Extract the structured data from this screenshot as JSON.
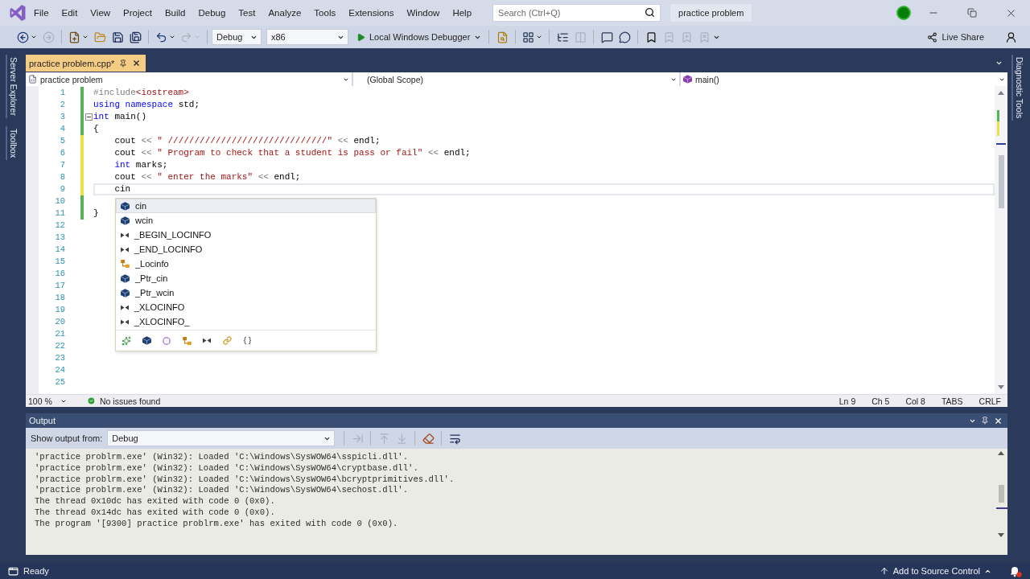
{
  "title_bar": {
    "menus": [
      "File",
      "Edit",
      "View",
      "Project",
      "Build",
      "Debug",
      "Test",
      "Analyze",
      "Tools",
      "Extensions",
      "Window",
      "Help"
    ],
    "search": {
      "placeholder": "Search (Ctrl+Q)"
    },
    "solution_name": "practice problem"
  },
  "toolbar": {
    "button_groups": [
      [
        {
          "kind": "back",
          "disabled": false
        },
        {
          "kind": "forward",
          "disabled": true
        }
      ],
      [
        {
          "kind": "project",
          "disabled": false
        },
        {
          "kind": "open",
          "disabled": false
        },
        {
          "kind": "save",
          "disabled": false
        },
        {
          "kind": "saveall",
          "disabled": false
        }
      ],
      [
        {
          "kind": "undo",
          "disabled": false
        },
        {
          "kind": "redo",
          "disabled": true
        }
      ]
    ],
    "configuration": "Debug",
    "platform": "x86",
    "start_label": "Local Windows Debugger",
    "tool_groups": [
      [
        {
          "kind": "find",
          "disabled": false
        }
      ],
      [
        {
          "kind": "grid",
          "disabled": false
        }
      ],
      [
        {
          "kind": "tree",
          "disabled": false
        },
        {
          "kind": "columns",
          "disabled": true
        }
      ],
      [
        {
          "kind": "comment",
          "disabled": false
        },
        {
          "kind": "uncomment",
          "disabled": false
        }
      ],
      [
        {
          "kind": "bookmark",
          "disabled": false
        },
        {
          "kind": "bookmarkprev",
          "disabled": true
        },
        {
          "kind": "bookmarknext",
          "disabled": true
        },
        {
          "kind": "bookmarkclear",
          "disabled": true
        }
      ]
    ],
    "live_share": "Live Share"
  },
  "left_tool_tabs": [
    "Server Explorer",
    "Toolbox"
  ],
  "right_tool_tabs": [
    "Diagnostic Tools"
  ],
  "document_tabs": [
    {
      "label": "practice problem.cpp*",
      "selected": true
    }
  ],
  "navigation_bar": {
    "project": "practice problem",
    "scope": "(Global Scope)",
    "member": "main()"
  },
  "editor": {
    "lines": [
      {
        "number": "1",
        "color": "#55b35a",
        "current": false,
        "collapsible": false,
        "code": [
          {
            "kind": "preprocessor",
            "text": "#include"
          },
          {
            "kind": "string",
            "text": "<iostream>"
          }
        ]
      },
      {
        "number": "2",
        "color": "#55b35a",
        "current": false,
        "collapsible": false,
        "code": [
          {
            "kind": "keyword",
            "text": "using"
          },
          {
            "kind": "keyword",
            "text": " namespace"
          },
          {
            "kind": "plain",
            "text": " std;"
          }
        ]
      },
      {
        "number": "3",
        "color": "#55b35a",
        "current": false,
        "collapsible": true,
        "code": [
          {
            "kind": "keyword",
            "text": "int"
          },
          {
            "kind": "plain",
            "text": " main()"
          }
        ]
      },
      {
        "number": "4",
        "color": "#55b35a",
        "current": false,
        "collapsible": false,
        "code": [
          {
            "kind": "plain",
            "text": "{"
          }
        ]
      },
      {
        "number": "5",
        "color": "#ecdf4e",
        "current": false,
        "collapsible": false,
        "code": [
          {
            "kind": "plain",
            "text": "    cout "
          },
          {
            "kind": "operator",
            "text": "<<"
          },
          {
            "kind": "string",
            "text": " \" //////////////////////////////\" "
          },
          {
            "kind": "operator",
            "text": "<<"
          },
          {
            "kind": "plain",
            "text": " endl;"
          }
        ]
      },
      {
        "number": "6",
        "color": "#ecdf4e",
        "current": false,
        "collapsible": false,
        "code": [
          {
            "kind": "plain",
            "text": "    cout "
          },
          {
            "kind": "operator",
            "text": "<<"
          },
          {
            "kind": "string",
            "text": " \" Program to check that a student is pass or fail\" "
          },
          {
            "kind": "operator",
            "text": "<<"
          },
          {
            "kind": "plain",
            "text": " endl;"
          }
        ]
      },
      {
        "number": "7",
        "color": "#ecdf4e",
        "current": false,
        "collapsible": false,
        "code": [
          {
            "kind": "keyword",
            "text": "    int"
          },
          {
            "kind": "plain",
            "text": " marks;"
          }
        ]
      },
      {
        "number": "8",
        "color": "#ecdf4e",
        "current": false,
        "collapsible": false,
        "code": [
          {
            "kind": "plain",
            "text": "    cout "
          },
          {
            "kind": "operator",
            "text": "<<"
          },
          {
            "kind": "string",
            "text": " \" enter the marks\" "
          },
          {
            "kind": "operator",
            "text": "<<"
          },
          {
            "kind": "plain",
            "text": " endl;"
          }
        ]
      },
      {
        "number": "9",
        "color": "#ecdf4e",
        "current": true,
        "collapsible": false,
        "code": [
          {
            "kind": "plain",
            "text": "    cin"
          }
        ]
      },
      {
        "number": "10",
        "color": "#55b35a",
        "current": false,
        "collapsible": false
      },
      {
        "number": "11",
        "color": "#55b35a",
        "current": false,
        "collapsible": false,
        "code": [
          {
            "kind": "plain",
            "text": "}"
          }
        ]
      },
      {
        "number": "12",
        "current": false,
        "collapsible": false
      },
      {
        "number": "13",
        "current": false,
        "collapsible": false
      },
      {
        "number": "14",
        "current": false,
        "collapsible": false
      },
      {
        "number": "15",
        "current": false,
        "collapsible": false
      },
      {
        "number": "16",
        "current": false,
        "collapsible": false
      },
      {
        "number": "17",
        "current": false,
        "collapsible": false
      },
      {
        "number": "18",
        "current": false,
        "collapsible": false
      },
      {
        "number": "19",
        "current": false,
        "collapsible": false
      },
      {
        "number": "20",
        "current": false,
        "collapsible": false
      },
      {
        "number": "21",
        "current": false,
        "collapsible": false
      },
      {
        "number": "22",
        "current": false,
        "collapsible": false
      },
      {
        "number": "23",
        "current": false,
        "collapsible": false
      },
      {
        "number": "24",
        "current": false,
        "collapsible": false
      },
      {
        "number": "25",
        "current": false,
        "collapsible": false
      }
    ]
  },
  "completion": {
    "items": [
      {
        "label": "cin",
        "kind": "variable",
        "selected": true
      },
      {
        "label": "wcin",
        "kind": "variable",
        "selected": false
      },
      {
        "label": "_BEGIN_LOCINFO",
        "kind": "macro",
        "selected": false
      },
      {
        "label": "_END_LOCINFO",
        "kind": "macro",
        "selected": false
      },
      {
        "label": "_Locinfo",
        "kind": "class",
        "selected": false
      },
      {
        "label": "_Ptr_cin",
        "kind": "variable",
        "selected": false
      },
      {
        "label": "_Ptr_wcin",
        "kind": "variable",
        "selected": false
      },
      {
        "label": "_XLOCINFO",
        "kind": "macro",
        "selected": false
      },
      {
        "label": "_XLOCINFO_",
        "kind": "macro",
        "selected": false
      }
    ],
    "filters": [
      {
        "kind": "all",
        "selected": false
      },
      {
        "kind": "variable",
        "selected": false
      },
      {
        "kind": "function",
        "selected": false
      },
      {
        "kind": "class",
        "selected": false
      },
      {
        "kind": "macro",
        "selected": false
      },
      {
        "kind": "type",
        "selected": false
      },
      {
        "kind": "namespace",
        "selected": false
      }
    ]
  },
  "editor_status": {
    "zoom": "100 %",
    "issues": "No issues found",
    "position": [
      "Ln 9",
      "Ch 5",
      "Col 8",
      "TABS",
      "CRLF"
    ]
  },
  "output": {
    "title": "Output",
    "source_label": "Show output from:",
    "source": "Debug",
    "tool_groups": [
      [
        {
          "kind": "goto",
          "disabled": true
        }
      ],
      [
        {
          "kind": "prev",
          "disabled": true
        },
        {
          "kind": "next",
          "disabled": true
        }
      ],
      [
        {
          "kind": "clear",
          "disabled": false
        }
      ],
      [
        {
          "kind": "wrap",
          "disabled": false
        }
      ]
    ],
    "lines": [
      "'practice problrm.exe' (Win32): Loaded 'C:\\Windows\\SysWOW64\\sspicli.dll'.",
      "'practice problrm.exe' (Win32): Loaded 'C:\\Windows\\SysWOW64\\cryptbase.dll'.",
      "'practice problrm.exe' (Win32): Loaded 'C:\\Windows\\SysWOW64\\bcryptprimitives.dll'.",
      "'practice problrm.exe' (Win32): Loaded 'C:\\Windows\\SysWOW64\\sechost.dll'.",
      "The thread 0x10dc has exited with code 0 (0x0).",
      "The thread 0x14dc has exited with code 0 (0x0).",
      "The program '[9300] practice problrm.exe' has exited with code 0 (0x0)."
    ]
  },
  "status_bar": {
    "state": "Ready",
    "source_control": "Add to Source Control"
  }
}
